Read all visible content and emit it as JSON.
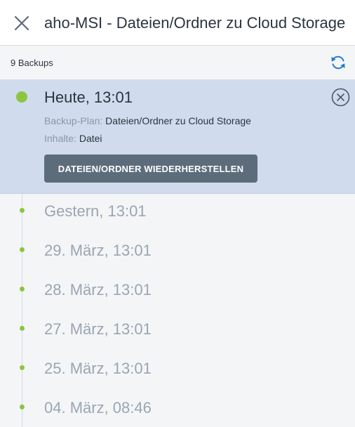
{
  "header": {
    "title": "aho-MSI - Dateien/Ordner zu Cloud Storage",
    "close_icon": "close-icon"
  },
  "toolbar": {
    "backup_count": "9 Backups",
    "refresh_icon": "refresh-icon"
  },
  "selected_backup": {
    "date": "Heute, 13:01",
    "plan_label": "Backup-Plan:",
    "plan_value": "Dateien/Ordner zu Cloud Storage",
    "contents_label": "Inhalte:",
    "contents_value": "Datei",
    "restore_button": "DATEIEN/ORDNER WIEDERHERSTELLEN"
  },
  "backups": [
    {
      "date": "Gestern, 13:01"
    },
    {
      "date": "29. März, 13:01"
    },
    {
      "date": "28. März, 13:01"
    },
    {
      "date": "27. März, 13:01"
    },
    {
      "date": "25. März, 13:01"
    },
    {
      "date": "04. März, 08:46"
    }
  ],
  "colors": {
    "accent_green": "#8cc63e",
    "selected_bg": "#d0dced",
    "button_bg": "#5d6c7b",
    "refresh_blue": "#1c7ad0"
  }
}
